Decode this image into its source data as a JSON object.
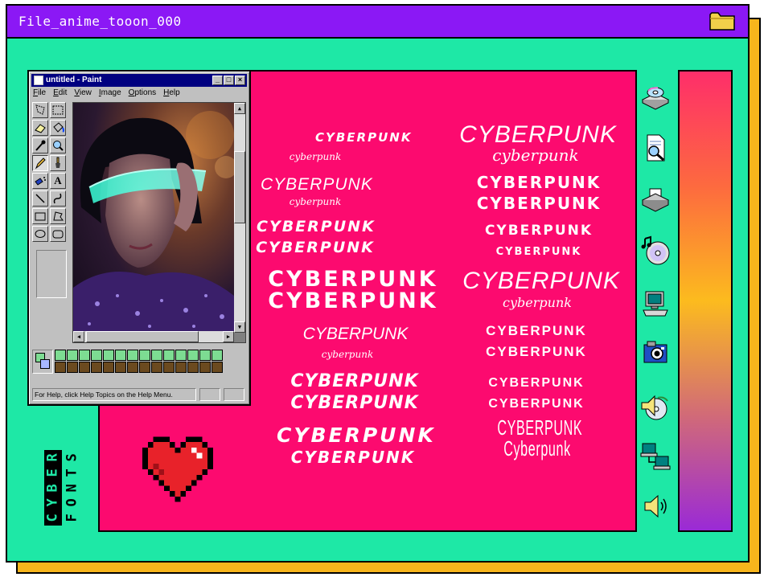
{
  "window": {
    "title": "File_anime_tooon_000",
    "icons": {
      "title_icon": "folder-icon"
    }
  },
  "paint": {
    "title": "untitled - Paint",
    "menu": [
      "File",
      "Edit",
      "View",
      "Image",
      "Options",
      "Help"
    ],
    "window_buttons": [
      "_",
      "□",
      "×"
    ],
    "tools": [
      "free-select",
      "rect-select",
      "eraser",
      "fill",
      "color-picker",
      "magnifier",
      "pencil",
      "brush",
      "airbrush",
      "A",
      "line",
      "curve",
      "rectangle",
      "polygon",
      "ellipse",
      "rounded-rectangle"
    ],
    "text_tool_label": "A",
    "status": "For Help, click Help Topics on the Help Menu.",
    "palette_top": [
      "#7ddc92",
      "#7ddc92",
      "#7ddc92",
      "#7ddc92",
      "#7ddc92",
      "#7ddc92",
      "#7ddc92",
      "#7ddc92",
      "#7ddc92",
      "#7ddc92",
      "#7ddc92",
      "#7ddc92",
      "#7ddc92",
      "#7ddc92"
    ],
    "palette_bottom": [
      "#6b4a1f",
      "#6b4a1f",
      "#6b4a1f",
      "#6b4a1f",
      "#6b4a1f",
      "#6b4a1f",
      "#6b4a1f",
      "#6b4a1f",
      "#6b4a1f",
      "#6b4a1f",
      "#6b4a1f",
      "#6b4a1f",
      "#6b4a1f",
      "#6b4a1f"
    ]
  },
  "samples": {
    "word": "CYBERPUNK",
    "word_lower": "cyberpunk",
    "word_mixed": "Cyberpunk"
  },
  "side_icons": [
    "cd-drive-icon",
    "document-search-icon",
    "printer-icon",
    "music-cd-icon",
    "computer-icon",
    "camera-icon",
    "speaker-cd-icon",
    "network-icon",
    "volume-icon"
  ],
  "logo": {
    "line1": "CYBER",
    "line2": "FONTS"
  },
  "colors": {
    "background": "#1ee8a6",
    "titlebar": "#8b18f5",
    "shadow": "#f7b51c",
    "canvas": "#fc0a6f",
    "heart": "#e8222a"
  }
}
